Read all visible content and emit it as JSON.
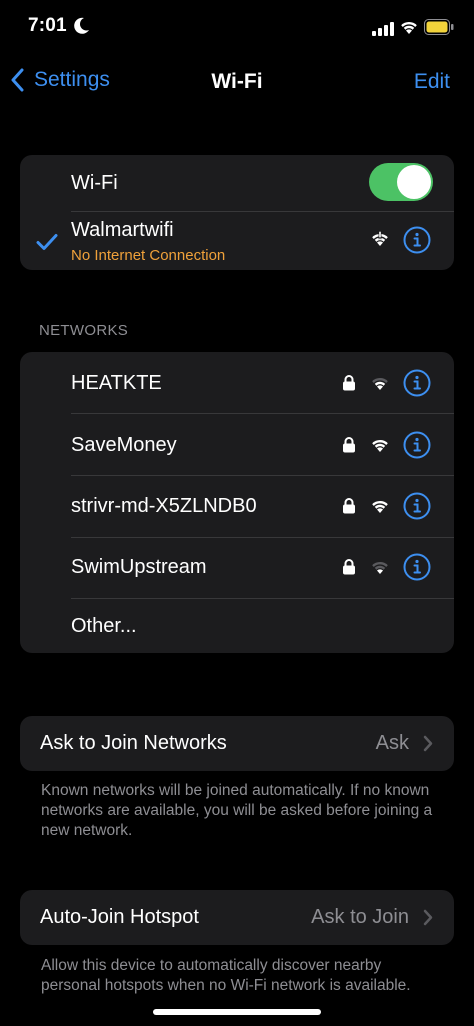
{
  "status_bar": {
    "time": "7:01"
  },
  "nav": {
    "back_label": "Settings",
    "title": "Wi-Fi",
    "edit_label": "Edit"
  },
  "wifi_toggle": {
    "label": "Wi-Fi",
    "enabled": true
  },
  "connected": {
    "name": "Walmartwifi",
    "status": "No Internet Connection",
    "status_color": "#f0a13a"
  },
  "networks_header": "NETWORKS",
  "networks": [
    {
      "name": "HEATKTE",
      "secured": true
    },
    {
      "name": "SaveMoney",
      "secured": true
    },
    {
      "name": "strivr-md-X5ZLNDB0",
      "secured": true
    },
    {
      "name": "SwimUpstream",
      "secured": true
    }
  ],
  "other_label": "Other...",
  "ask_to_join": {
    "label": "Ask to Join Networks",
    "value": "Ask",
    "footnote": "Known networks will be joined automatically. If no known networks are available, you will be asked before joining a new network."
  },
  "auto_join": {
    "label": "Auto-Join Hotspot",
    "value": "Ask to Join",
    "footnote": "Allow this device to automatically discover nearby personal hotspots when no Wi-Fi network is available."
  },
  "colors": {
    "accent": "#3d8ff0",
    "toggle_on": "#4cc265",
    "battery": "#f2d33b"
  },
  "icons": [
    "moon-icon",
    "cellular-signal-icon",
    "wifi-icon",
    "battery-icon",
    "back-chevron-icon",
    "checkmark-icon",
    "lock-icon",
    "info-icon",
    "chevron-right-icon"
  ]
}
